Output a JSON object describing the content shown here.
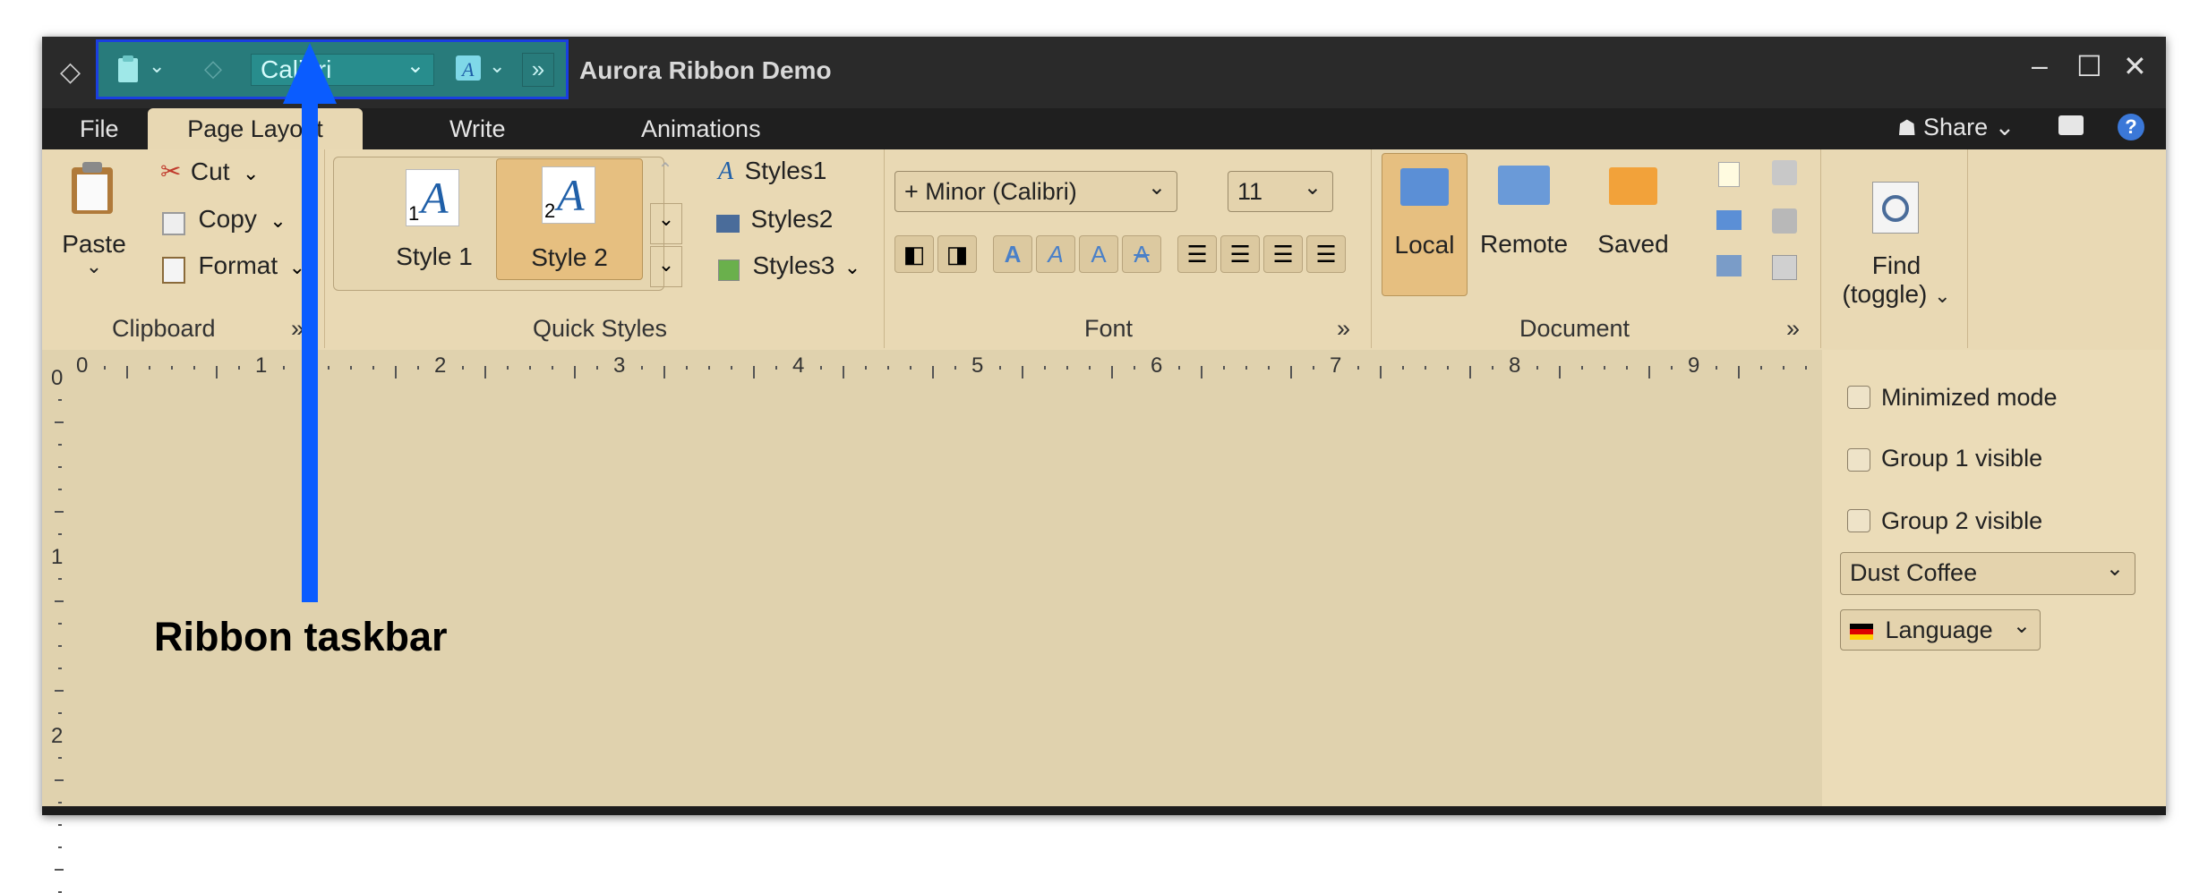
{
  "window": {
    "title": "Aurora Ribbon Demo"
  },
  "quick_access": {
    "font_value": "Calibri",
    "overflow": "»"
  },
  "window_controls": {
    "minimize": "–",
    "maximize": "☐",
    "close": "✕"
  },
  "tabs": {
    "file": "File",
    "page_layout": "Page Layout",
    "write": "Write",
    "animations": "Animations"
  },
  "top_right": {
    "share": "Share",
    "help": "?"
  },
  "ribbon": {
    "clipboard": {
      "paste": "Paste",
      "cut": "Cut",
      "copy": "Copy",
      "format": "Format",
      "label": "Clipboard",
      "expand": "»"
    },
    "quick_styles": {
      "style1": "Style 1",
      "style2": "Style 2",
      "style1_num": "1",
      "style2_num": "2",
      "styles1": "Styles1",
      "styles2": "Styles2",
      "styles3": "Styles3",
      "label": "Quick Styles"
    },
    "font": {
      "family": "+ Minor (Calibri)",
      "size": "11",
      "label": "Font",
      "expand": "»"
    },
    "document": {
      "local": "Local",
      "remote": "Remote",
      "saved": "Saved",
      "label": "Document",
      "expand": "»"
    },
    "find": {
      "line1": "Find",
      "line2": "(toggle)"
    }
  },
  "ruler": {
    "h": [
      "0",
      "1",
      "2",
      "3",
      "4",
      "5",
      "6",
      "7",
      "8",
      "9"
    ],
    "v": [
      "0",
      "1",
      "2"
    ]
  },
  "right_panel": {
    "minimized_mode": "Minimized mode",
    "group1_visible": "Group 1 visible",
    "group2_visible": "Group 2 visible",
    "skin": "Dust Coffee",
    "language": "Language"
  },
  "annotation": {
    "label": "Ribbon taskbar"
  },
  "colors": {
    "ribbon_bg": "#e9d9b4",
    "titlebar_bg": "#2a2a2a",
    "highlight": "#26bebe",
    "arrow": "#0a5cff",
    "selected_button": "#e6bf80"
  }
}
